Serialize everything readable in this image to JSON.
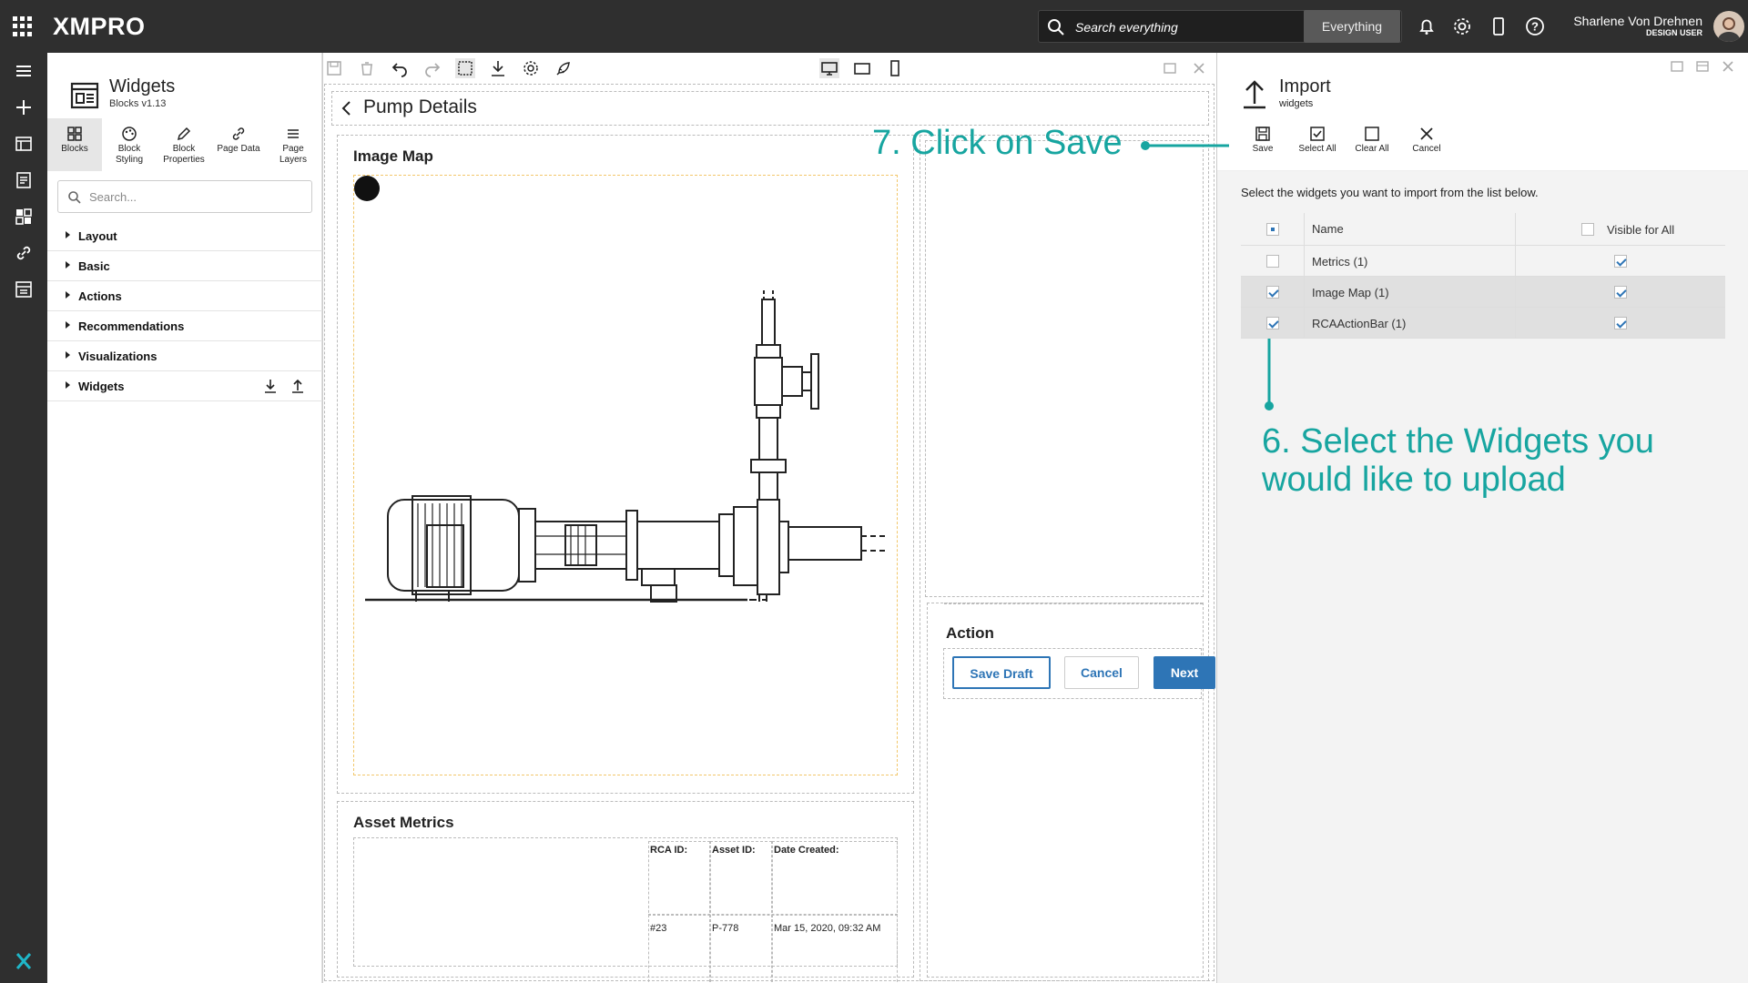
{
  "topbar": {
    "logo": "XMPRO",
    "search_placeholder": "Search everything",
    "search_scope": "Everything",
    "user_name": "Sharlene Von Drehnen",
    "user_role": "DESIGN USER"
  },
  "blocks_panel": {
    "title": "Widgets",
    "subtitle": "Blocks v1.13",
    "tools": [
      {
        "label": "Blocks",
        "icon": "blocks-icon"
      },
      {
        "label": "Block Styling",
        "icon": "palette-icon"
      },
      {
        "label": "Block Properties",
        "icon": "pencil-icon"
      },
      {
        "label": "Page Data",
        "icon": "link-icon"
      },
      {
        "label": "Page Layers",
        "icon": "layers-icon"
      }
    ],
    "search_placeholder": "Search...",
    "categories": [
      "Layout",
      "Basic",
      "Actions",
      "Recommendations",
      "Visualizations",
      "Widgets"
    ]
  },
  "canvas": {
    "page_title": "Pump Details",
    "image_map_title": "Image Map",
    "asset_metrics_title": "Asset Metrics",
    "metrics_headers": [
      "RCA ID:",
      "Asset ID:",
      "Date Created:"
    ],
    "metrics_values": [
      "#23",
      "P-778",
      "Mar 15, 2020, 09:32 AM"
    ],
    "action_title": "Action",
    "buttons": {
      "save_draft": "Save Draft",
      "cancel": "Cancel",
      "next": "Next"
    }
  },
  "import_panel": {
    "title": "Import",
    "subtitle": "widgets",
    "tools": [
      {
        "label": "Save",
        "icon": "save-icon"
      },
      {
        "label": "Select All",
        "icon": "select-all-icon"
      },
      {
        "label": "Clear All",
        "icon": "clear-all-icon"
      },
      {
        "label": "Cancel",
        "icon": "close-icon"
      }
    ],
    "instruction": "Select the widgets you want to import from the list below.",
    "col_name": "Name",
    "col_visible": "Visible for All",
    "rows": [
      {
        "name": "Metrics (1)",
        "selected": false,
        "visible": true
      },
      {
        "name": "Image Map (1)",
        "selected": true,
        "visible": true
      },
      {
        "name": "RCAActionBar (1)",
        "selected": true,
        "visible": true
      }
    ]
  },
  "annotations": {
    "step7": "7. Click on Save",
    "step6_line1": "6. Select the Widgets you",
    "step6_line2": "would like to upload"
  },
  "colors": {
    "topbar": "#2f2f2f",
    "accent": "#2e75b6",
    "annotation": "#17a5a0"
  }
}
